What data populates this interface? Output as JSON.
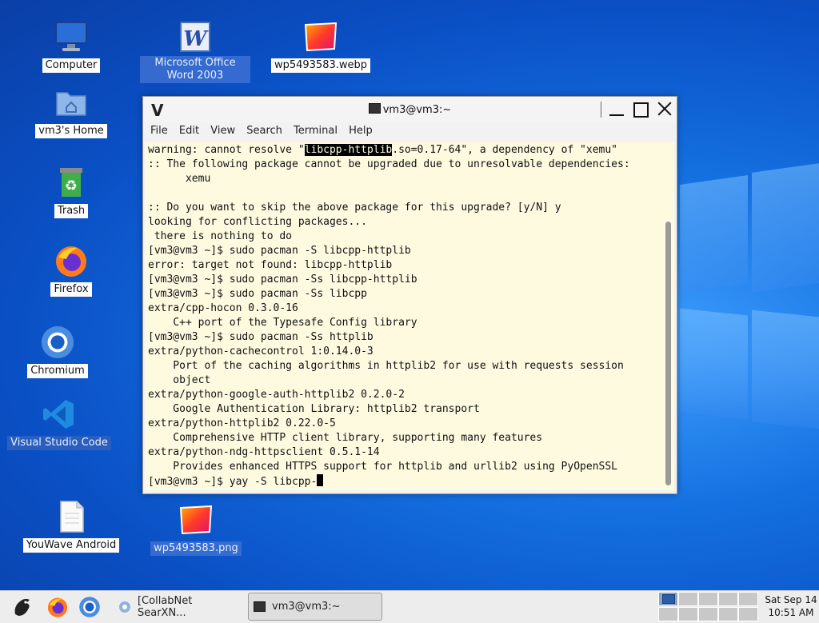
{
  "desktop": {
    "icons": [
      {
        "label": "Computer"
      },
      {
        "label": "Microsoft Office Word 2003"
      },
      {
        "label": "wp5493583.webp"
      },
      {
        "label": "vm3's Home"
      },
      {
        "label": "Trash"
      },
      {
        "label": "Firefox"
      },
      {
        "label": "Chromium"
      },
      {
        "label": "Visual Studio Code"
      },
      {
        "label": "YouWave Android"
      },
      {
        "label": "wp5493583.png"
      }
    ]
  },
  "window": {
    "title": "vm3@vm3:~",
    "menu": [
      "File",
      "Edit",
      "View",
      "Search",
      "Terminal",
      "Help"
    ]
  },
  "terminal": {
    "first_line_pre": "warning: cannot resolve \"",
    "first_line_highlight": "libcpp-httplib",
    "first_line_post": ".so=0.17-64\", a dependency of \"xemu\"",
    "lines": [
      ":: The following package cannot be upgraded due to unresolvable dependencies:",
      "      xemu",
      "",
      ":: Do you want to skip the above package for this upgrade? [y/N] y",
      "looking for conflicting packages...",
      " there is nothing to do",
      "[vm3@vm3 ~]$ sudo pacman -S libcpp-httplib",
      "error: target not found: libcpp-httplib",
      "[vm3@vm3 ~]$ sudo pacman -Ss libcpp-httplib",
      "[vm3@vm3 ~]$ sudo pacman -Ss libcpp",
      "extra/cpp-hocon 0.3.0-16",
      "    C++ port of the Typesafe Config library",
      "[vm3@vm3 ~]$ sudo pacman -Ss httplib",
      "extra/python-cachecontrol 1:0.14.0-3",
      "    Port of the caching algorithms in httplib2 for use with requests session",
      "    object",
      "extra/python-google-auth-httplib2 0.2.0-2",
      "    Google Authentication Library: httplib2 transport",
      "extra/python-httplib2 0.22.0-5",
      "    Comprehensive HTTP client library, supporting many features",
      "extra/python-ndg-httpsclient 0.5.1-14",
      "    Provides enhanced HTTPS support for httplib and urllib2 using PyOpenSSL"
    ],
    "prompt_line": "[vm3@vm3 ~]$ yay -S libcpp-"
  },
  "taskbar": {
    "tasks": [
      {
        "label": "[CollabNet SearXN..."
      },
      {
        "label": "vm3@vm3:~"
      }
    ],
    "clock": {
      "date": "Sat Sep 14",
      "time": "10:51 AM"
    }
  },
  "colors": {
    "terminal_bg": "#fdfae0",
    "desktop_blue": "#1470e0",
    "selection": "#3a6fd2"
  }
}
